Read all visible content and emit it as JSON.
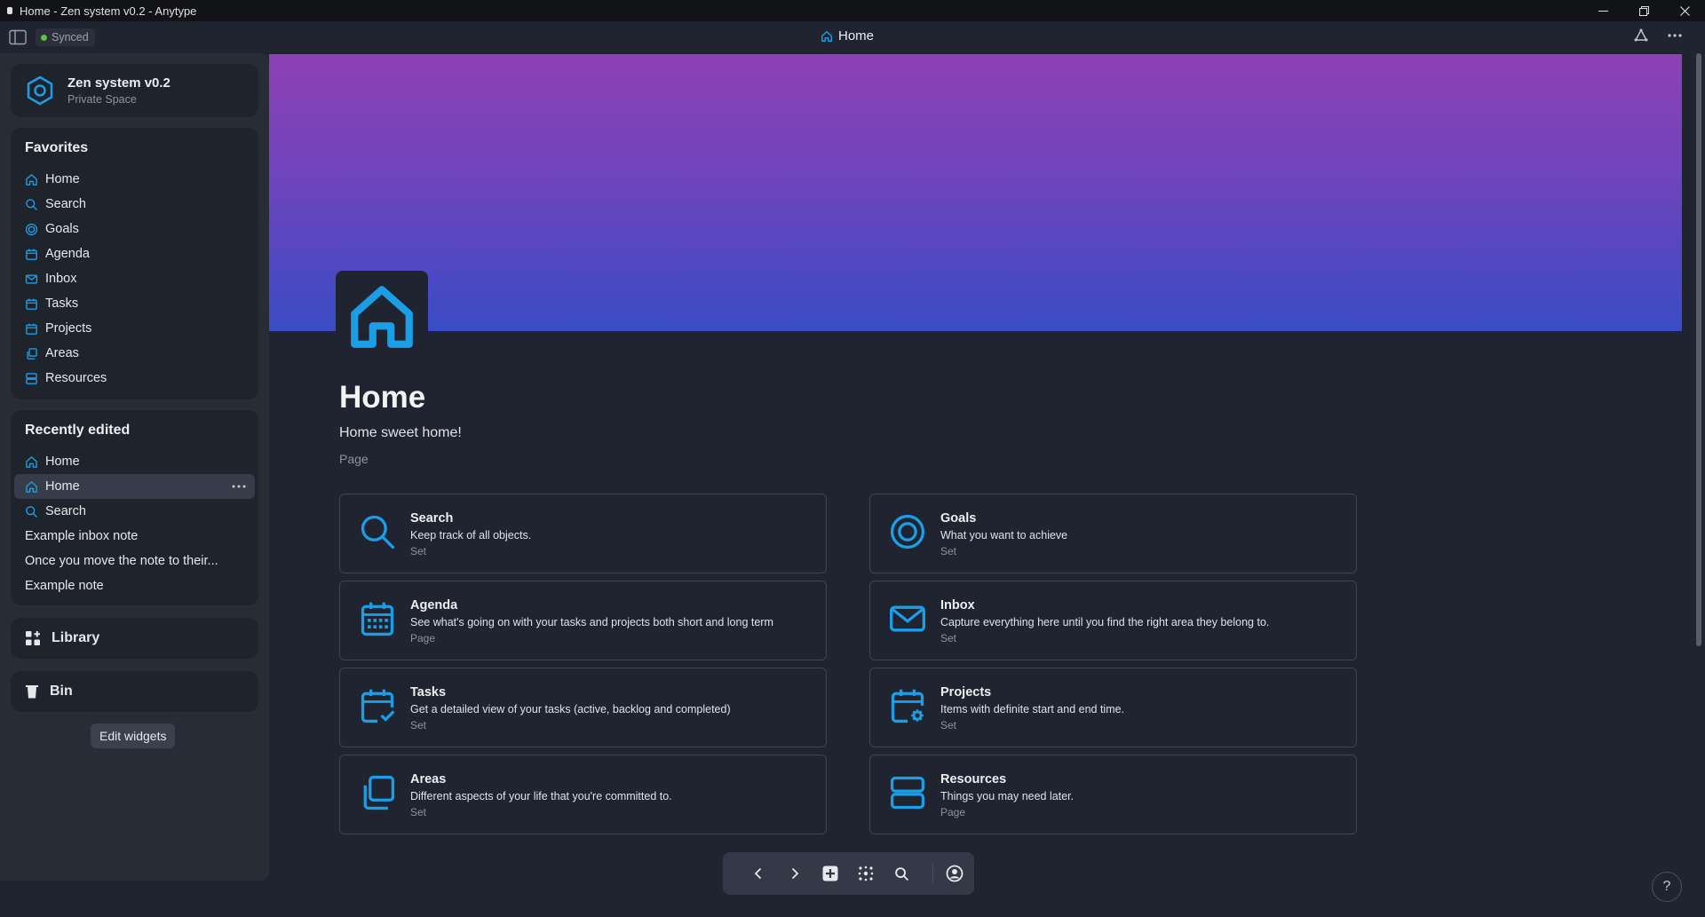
{
  "window": {
    "title": "Home - Zen system v0.2 - Anytype"
  },
  "header": {
    "sync_status": "Synced",
    "page_title": "Home"
  },
  "space": {
    "name": "Zen system v0.2",
    "type": "Private Space"
  },
  "favorites": {
    "title": "Favorites",
    "items": [
      {
        "label": "Home",
        "icon": "home-icon"
      },
      {
        "label": "Search",
        "icon": "search-icon"
      },
      {
        "label": "Goals",
        "icon": "target-icon"
      },
      {
        "label": "Agenda",
        "icon": "calendar-icon"
      },
      {
        "label": "Inbox",
        "icon": "mail-icon"
      },
      {
        "label": "Tasks",
        "icon": "calendar-check-icon"
      },
      {
        "label": "Projects",
        "icon": "calendar-gear-icon"
      },
      {
        "label": "Areas",
        "icon": "copy-icon"
      },
      {
        "label": "Resources",
        "icon": "server-icon"
      }
    ]
  },
  "recent": {
    "title": "Recently edited",
    "items": [
      {
        "label": "Home",
        "icon": "home-icon"
      },
      {
        "label": "Home",
        "icon": "home-icon",
        "active": true
      },
      {
        "label": "Search",
        "icon": "search-icon"
      },
      {
        "label": "Example inbox note"
      },
      {
        "label": "Once you move the note to their..."
      },
      {
        "label": "Example note"
      }
    ]
  },
  "library": {
    "label": "Library"
  },
  "bin": {
    "label": "Bin"
  },
  "edit_widgets": {
    "label": "Edit widgets"
  },
  "page": {
    "title": "Home",
    "description": "Home sweet home!",
    "type": "Page"
  },
  "cards": [
    {
      "title": "Search",
      "desc": "Keep track of all objects.",
      "type": "Set",
      "icon": "search-icon"
    },
    {
      "title": "Goals",
      "desc": "What you want to achieve",
      "type": "Set",
      "icon": "target-icon"
    },
    {
      "title": "Agenda",
      "desc": "See what's going on with your tasks and projects both short and long term",
      "type": "Page",
      "icon": "calendar-icon"
    },
    {
      "title": "Inbox",
      "desc": "Capture everything here until you find the right area they belong to.",
      "type": "Set",
      "icon": "mail-icon"
    },
    {
      "title": "Tasks",
      "desc": "Get a detailed view of your tasks (active, backlog and completed)",
      "type": "Set",
      "icon": "calendar-check-icon"
    },
    {
      "title": "Projects",
      "desc": "Items with definite start and end time.",
      "type": "Set",
      "icon": "calendar-gear-icon"
    },
    {
      "title": "Areas",
      "desc": "Different aspects of your life that you're committed to.",
      "type": "Set",
      "icon": "copy-icon"
    },
    {
      "title": "Resources",
      "desc": "Things you may need later.",
      "type": "Page",
      "icon": "server-icon"
    }
  ],
  "colors": {
    "accent": "#1c9ee6",
    "background": "#1f2430",
    "sidebar": "#272c37",
    "synced": "#5cc542"
  },
  "help": {
    "label": "?"
  }
}
